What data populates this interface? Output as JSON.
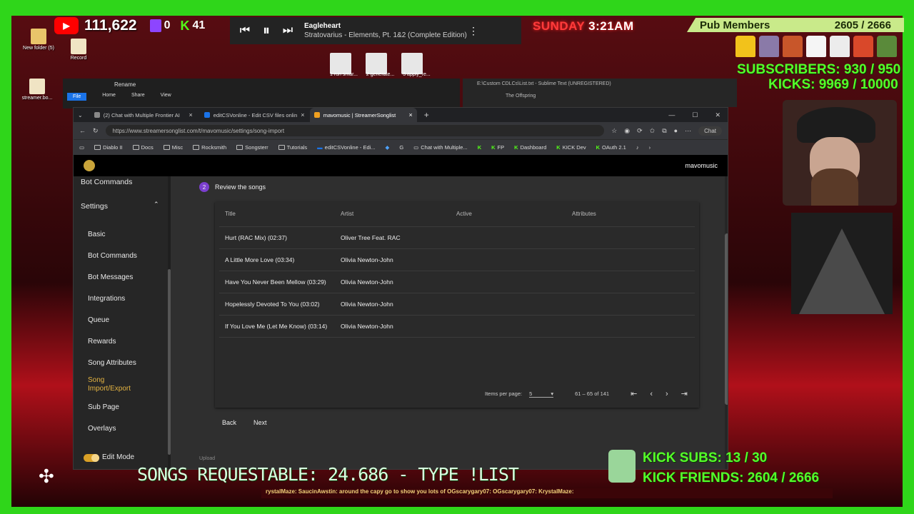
{
  "overlay": {
    "youtube_count": "111,622",
    "twitch_count": "0",
    "kick_count": "41",
    "now_playing": {
      "title": "Eagleheart",
      "subtitle": "Stratovarius - Elements, Pt. 1&2 (Complete Edition)"
    },
    "clock": {
      "day": "SUNDAY",
      "time": "3:21AM"
    },
    "pub_members_label": "Pub Members",
    "pub_members_value": "2605 / 2666",
    "subscribers": "SUBSCRIBERS: 930 / 950",
    "kicks": "KICKS: 9969 / 10000",
    "kick_subs": "KICK SUBS: 13 / 30",
    "kick_friends": "KICK FRIENDS: 2604 / 2666",
    "songs_requestable": "SONGS REQUESTABLE: 24.686 - TYPE !LIST",
    "chat_ticker": "rystalMaze:   SaucinAwstin: around the capy go               to show you lots of     OGscarygary07:      OGscarygary07:      KrystalMaze:",
    "colors": {
      "green_frame": "#2fd61a",
      "subs_text": "#55ff2a"
    }
  },
  "desktop": {
    "icons": [
      {
        "label": "New folder (5)",
        "icon": "folder-icon"
      },
      {
        "label": "Record",
        "icon": "file-icon"
      },
      {
        "label": "streamer.bo...",
        "icon": "file-icon"
      }
    ],
    "thumbnails": [
      "1 run smar...",
      "2 generate...",
      "3 apply_re..."
    ]
  },
  "explorer": {
    "title": "Rename",
    "ribbon": [
      "File",
      "Home",
      "Share",
      "View"
    ]
  },
  "sublime": {
    "title": "E:\\Custom CDLCs\\List.txt - Sublime Text (UNREGISTERED)",
    "folder": "The Offspring"
  },
  "browser": {
    "tabs": [
      {
        "label": "(2) Chat with Multiple Frontier AI"
      },
      {
        "label": "editCSVonline - Edit CSV files onlin"
      },
      {
        "label": "mavomusic | StreamerSonglist"
      }
    ],
    "url": "https://www.streamersonglist.com/t/mavomusic/settings/song-import",
    "chat_label": "Chat",
    "bookmarks": [
      "Diablo II",
      "Docs",
      "Misc",
      "Rocksmith",
      "Songsterr",
      "Tutorials",
      "editCSVonline - Edi...",
      "Chat with Multiple...",
      "FP",
      "Dashboard",
      "KICK Dev",
      "OAuth 2.1"
    ]
  },
  "app": {
    "brand": "mavomusic",
    "sidebar": {
      "top_items": [
        "Bot Commands",
        "Settings"
      ],
      "items": [
        "Basic",
        "Bot Commands",
        "Bot Messages",
        "Integrations",
        "Queue",
        "Rewards",
        "Song Attributes",
        "Song Import/Export",
        "Sub Page",
        "Overlays"
      ],
      "edit_mode_label": "Edit Mode"
    },
    "step": {
      "number": "2",
      "label": "Review the songs"
    },
    "table": {
      "headers": [
        "Title",
        "Artist",
        "Active",
        "Attributes"
      ],
      "rows": [
        {
          "title": "Hurt (RAC Mix) (02:37)",
          "artist": "Oliver Tree Feat. RAC"
        },
        {
          "title": "A Little More Love (03:34)",
          "artist": "Olivia Newton-John"
        },
        {
          "title": "Have You Never Been Mellow (03:29)",
          "artist": "Olivia Newton-John"
        },
        {
          "title": "Hopelessly Devoted To You (03:02)",
          "artist": "Olivia Newton-John"
        },
        {
          "title": "If You Love Me (Let Me Know) (03:14)",
          "artist": "Olivia Newton-John"
        }
      ]
    },
    "pager": {
      "items_per_page_label": "Items per page:",
      "items_per_page_value": "5",
      "range": "61 – 65 of 141"
    },
    "actions": {
      "back": "Back",
      "next": "Next"
    },
    "upload_label": "Upload"
  }
}
